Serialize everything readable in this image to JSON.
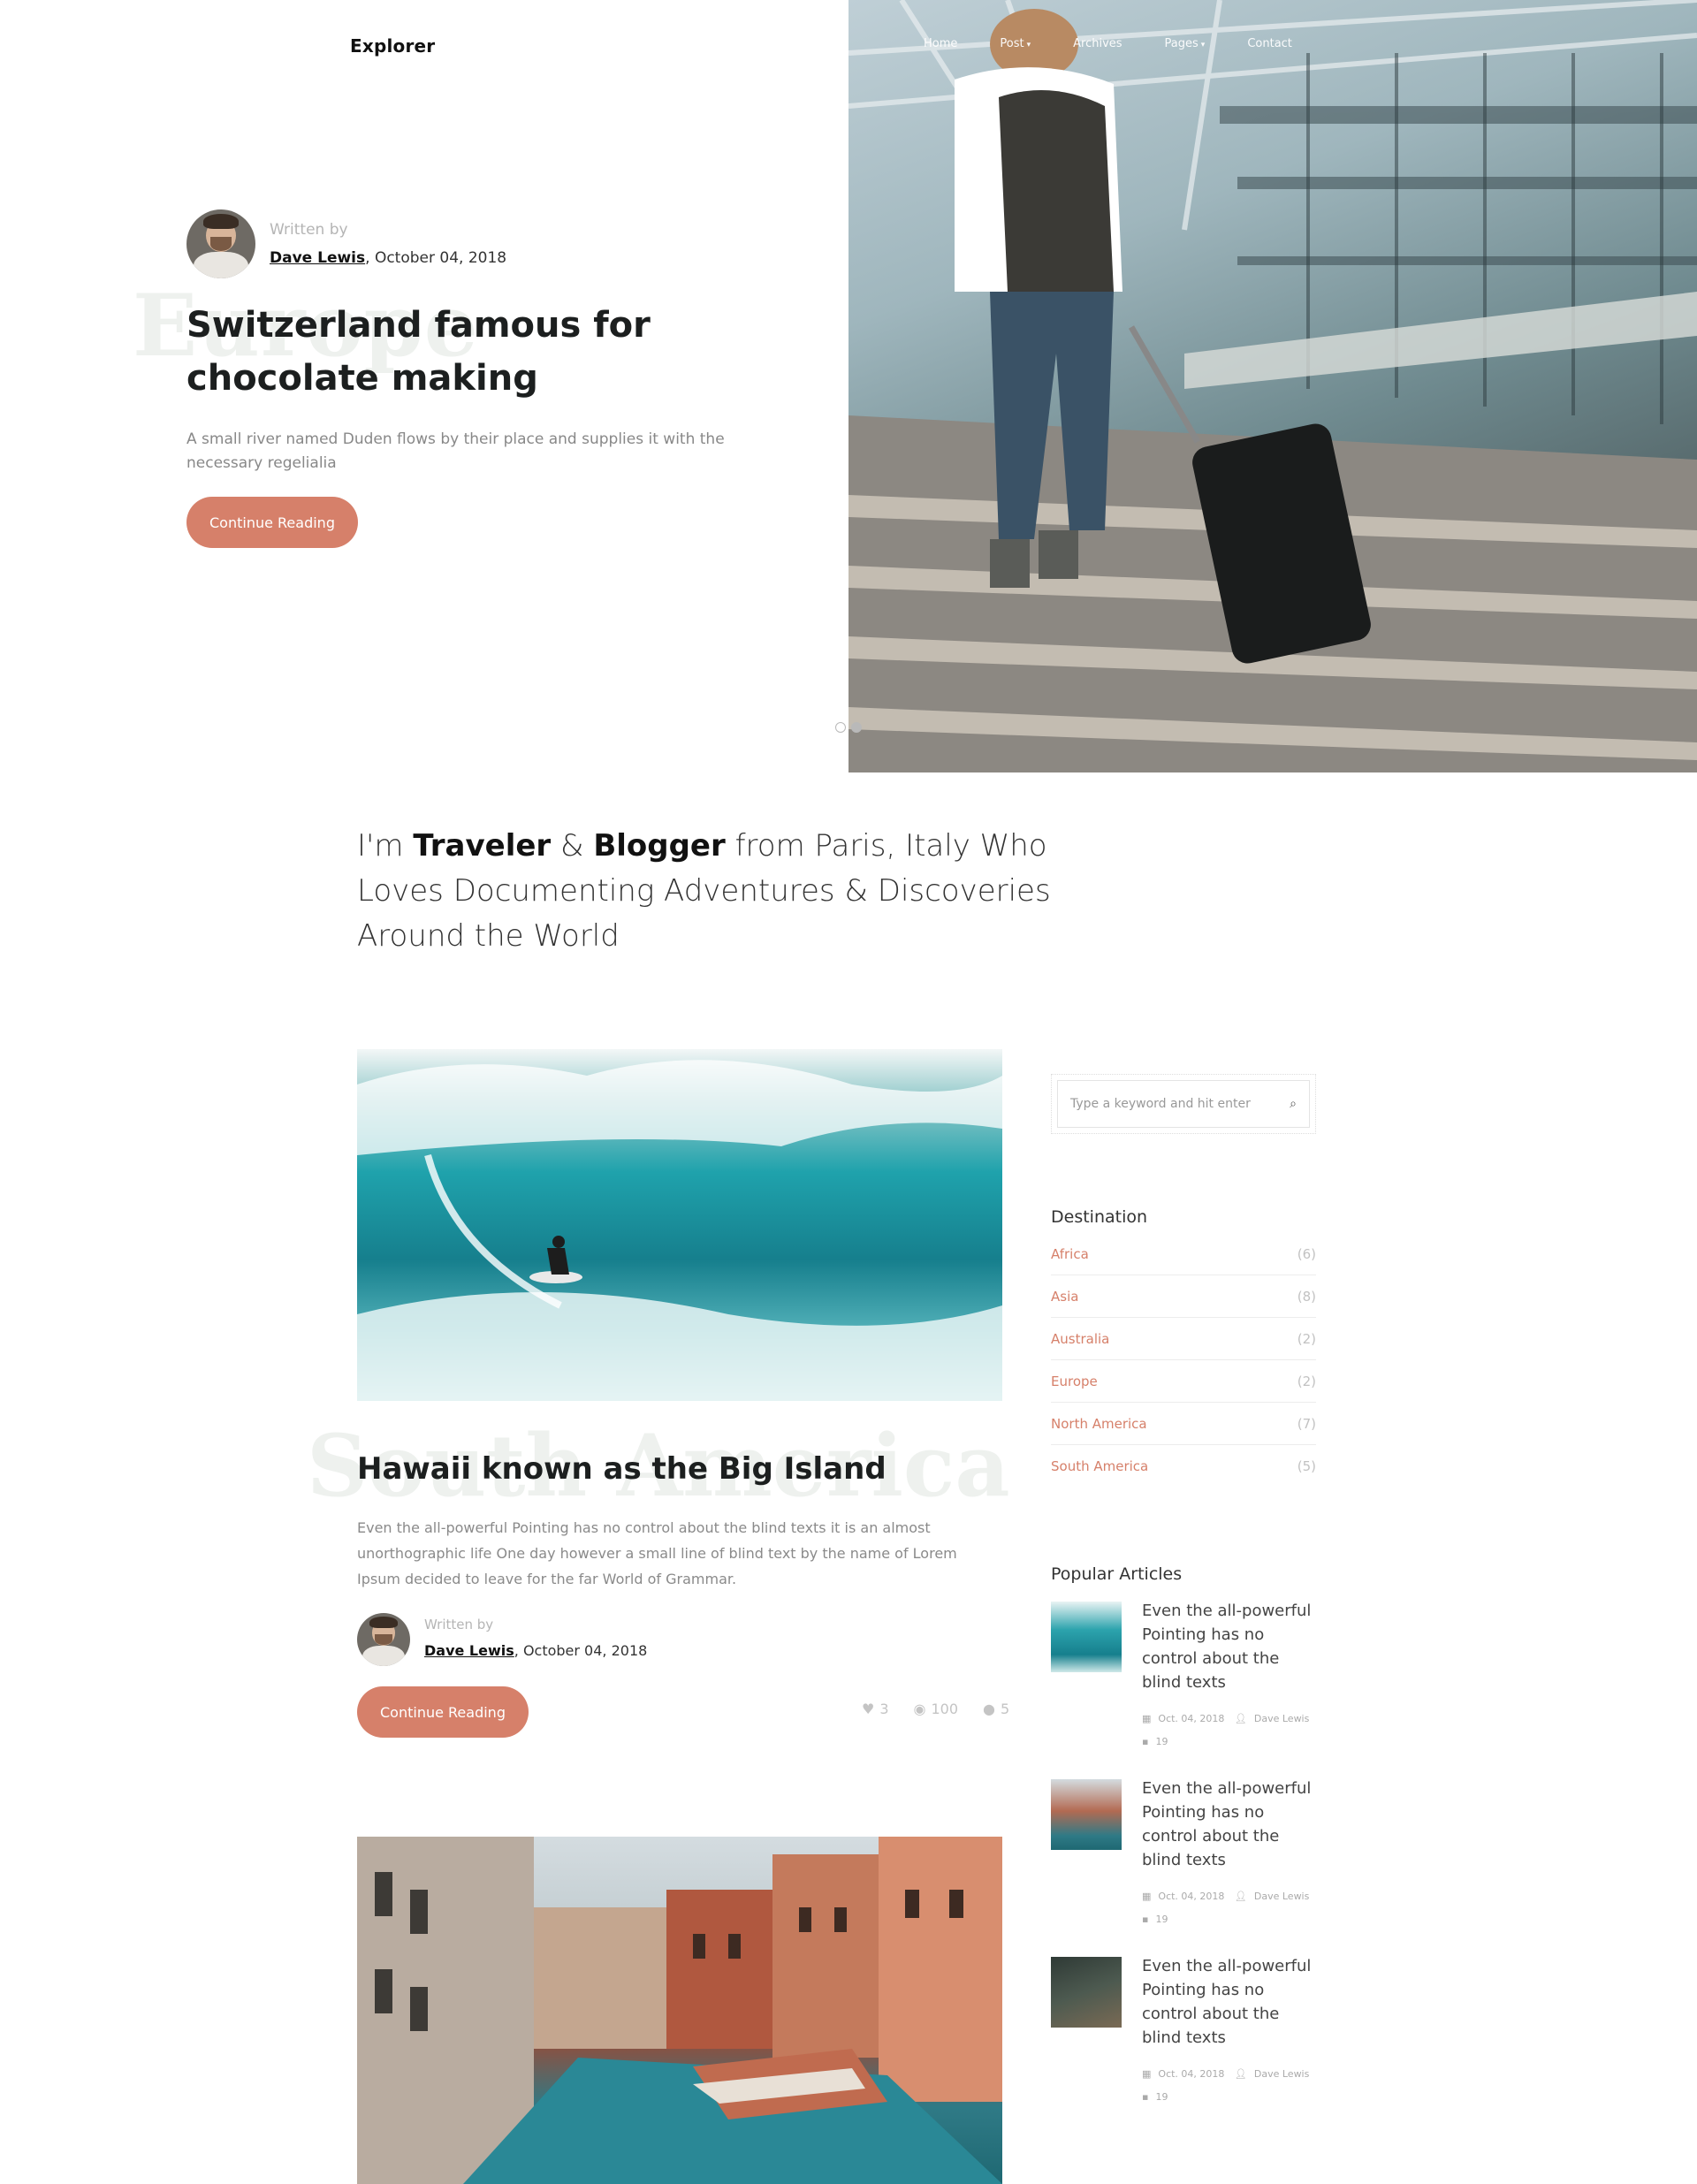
{
  "header": {
    "logo": "Explorer",
    "nav": [
      {
        "label": "Home",
        "dropdown": false
      },
      {
        "label": "Post",
        "dropdown": true
      },
      {
        "label": "Archives",
        "dropdown": false
      },
      {
        "label": "Pages",
        "dropdown": true
      },
      {
        "label": "Contact",
        "dropdown": false
      }
    ]
  },
  "hero": {
    "written_by": "Written by",
    "author": "Dave Lewis",
    "date": ", October 04, 2018",
    "watermark": "Europe",
    "title": "Switzerland famous for chocolate making",
    "excerpt": "A small river named Duden flows by their place and supplies it with the necessary regelialia",
    "button": "Continue Reading",
    "slide_count": 2,
    "active_slide": 2
  },
  "intro": {
    "pre": "I'm ",
    "bold1": "Traveler",
    "mid": " & ",
    "bold2": "Blogger",
    "post": " from Paris, Italy Who Loves Documenting Adventures & Discoveries Around the World"
  },
  "posts": [
    {
      "watermark": "South America",
      "title": "Hawaii known as the Big Island",
      "excerpt": "Even the all-powerful Pointing has no control about the blind texts it is an almost unorthographic life One day however a small line of blind text by the name of Lorem Ipsum decided to leave for the far World of Grammar.",
      "written_by": "Written by",
      "author": "Dave Lewis",
      "date": ", October 04, 2018",
      "button": "Continue Reading",
      "likes": "3",
      "views": "100",
      "comments": "5"
    }
  ],
  "sidebar": {
    "search_placeholder": "Type a keyword and hit enter",
    "destination_heading": "Destination",
    "destinations": [
      {
        "name": "Africa",
        "count": "(6)"
      },
      {
        "name": "Asia",
        "count": "(8)"
      },
      {
        "name": "Australia",
        "count": "(2)"
      },
      {
        "name": "Europe",
        "count": "(2)"
      },
      {
        "name": "North America",
        "count": "(7)"
      },
      {
        "name": "South America",
        "count": "(5)"
      }
    ],
    "popular_heading": "Popular Articles",
    "popular": [
      {
        "title": "Even the all-powerful Pointing has no control about the blind texts",
        "date": "Oct. 04, 2018",
        "author": "Dave Lewis",
        "comments": "19"
      },
      {
        "title": "Even the all-powerful Pointing has no control about the blind texts",
        "date": "Oct. 04, 2018",
        "author": "Dave Lewis",
        "comments": "19"
      },
      {
        "title": "Even the all-powerful Pointing has no control about the blind texts",
        "date": "Oct. 04, 2018",
        "author": "Dave Lewis",
        "comments": "19"
      }
    ]
  },
  "colors": {
    "accent": "#d6806a",
    "heading": "#1c1f1f",
    "muted": "#888888"
  }
}
